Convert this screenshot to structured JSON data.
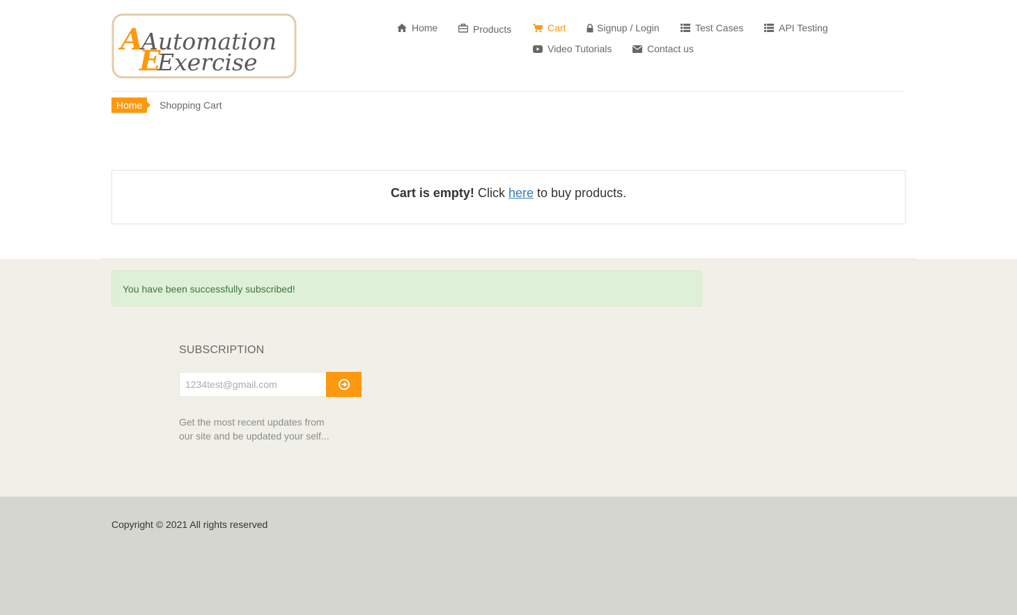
{
  "logo": {
    "line1": "Automation",
    "line2": "Exercise"
  },
  "nav": {
    "home": "Home",
    "products": "Products",
    "cart": "Cart",
    "signup_login": "Signup / Login",
    "test_cases": "Test Cases",
    "api_testing": "API Testing",
    "video_tutorials": "Video Tutorials",
    "contact_us": "Contact us"
  },
  "breadcrumb": {
    "home": "Home",
    "current": "Shopping Cart"
  },
  "cart": {
    "empty_bold": "Cart is empty!",
    "click": "Click",
    "link": "here",
    "suffix": "to buy products."
  },
  "alert": {
    "text": "You have been successfully subscribed!"
  },
  "subscription": {
    "title": "SUBSCRIPTION",
    "placeholder": "1234test@gmail.com",
    "note": "Get the most recent updates from our site and be updated your self..."
  },
  "footer": {
    "copyright": "Copyright © 2021 All rights reserved"
  },
  "colors": {
    "accent": "#FE980F",
    "link": "#337ab7",
    "success_bg": "#dff0d8",
    "success_text": "#3c763d",
    "footer_bg": "#f0f0e9",
    "footer_bottom_bg": "#d6d6d0"
  }
}
